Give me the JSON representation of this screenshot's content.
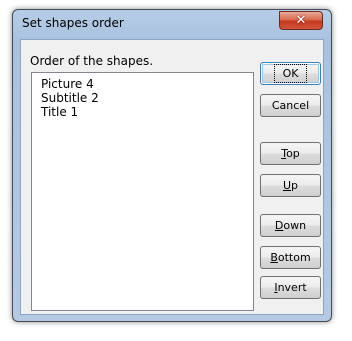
{
  "window": {
    "title": "Set shapes order",
    "close_glyph": "✕"
  },
  "group_label": "Order of the shapes.",
  "shapes": [
    "Picture 4",
    "Subtitle 2",
    "Title 1"
  ],
  "buttons": {
    "ok": "OK",
    "cancel": "Cancel",
    "top": {
      "accel": "T",
      "rest": "op"
    },
    "up": {
      "accel": "U",
      "rest": "p"
    },
    "down": {
      "accel": "D",
      "rest": "own"
    },
    "bottom": {
      "accel": "B",
      "rest": "ottom"
    },
    "invert": {
      "accel": "I",
      "rest": "nvert"
    }
  }
}
